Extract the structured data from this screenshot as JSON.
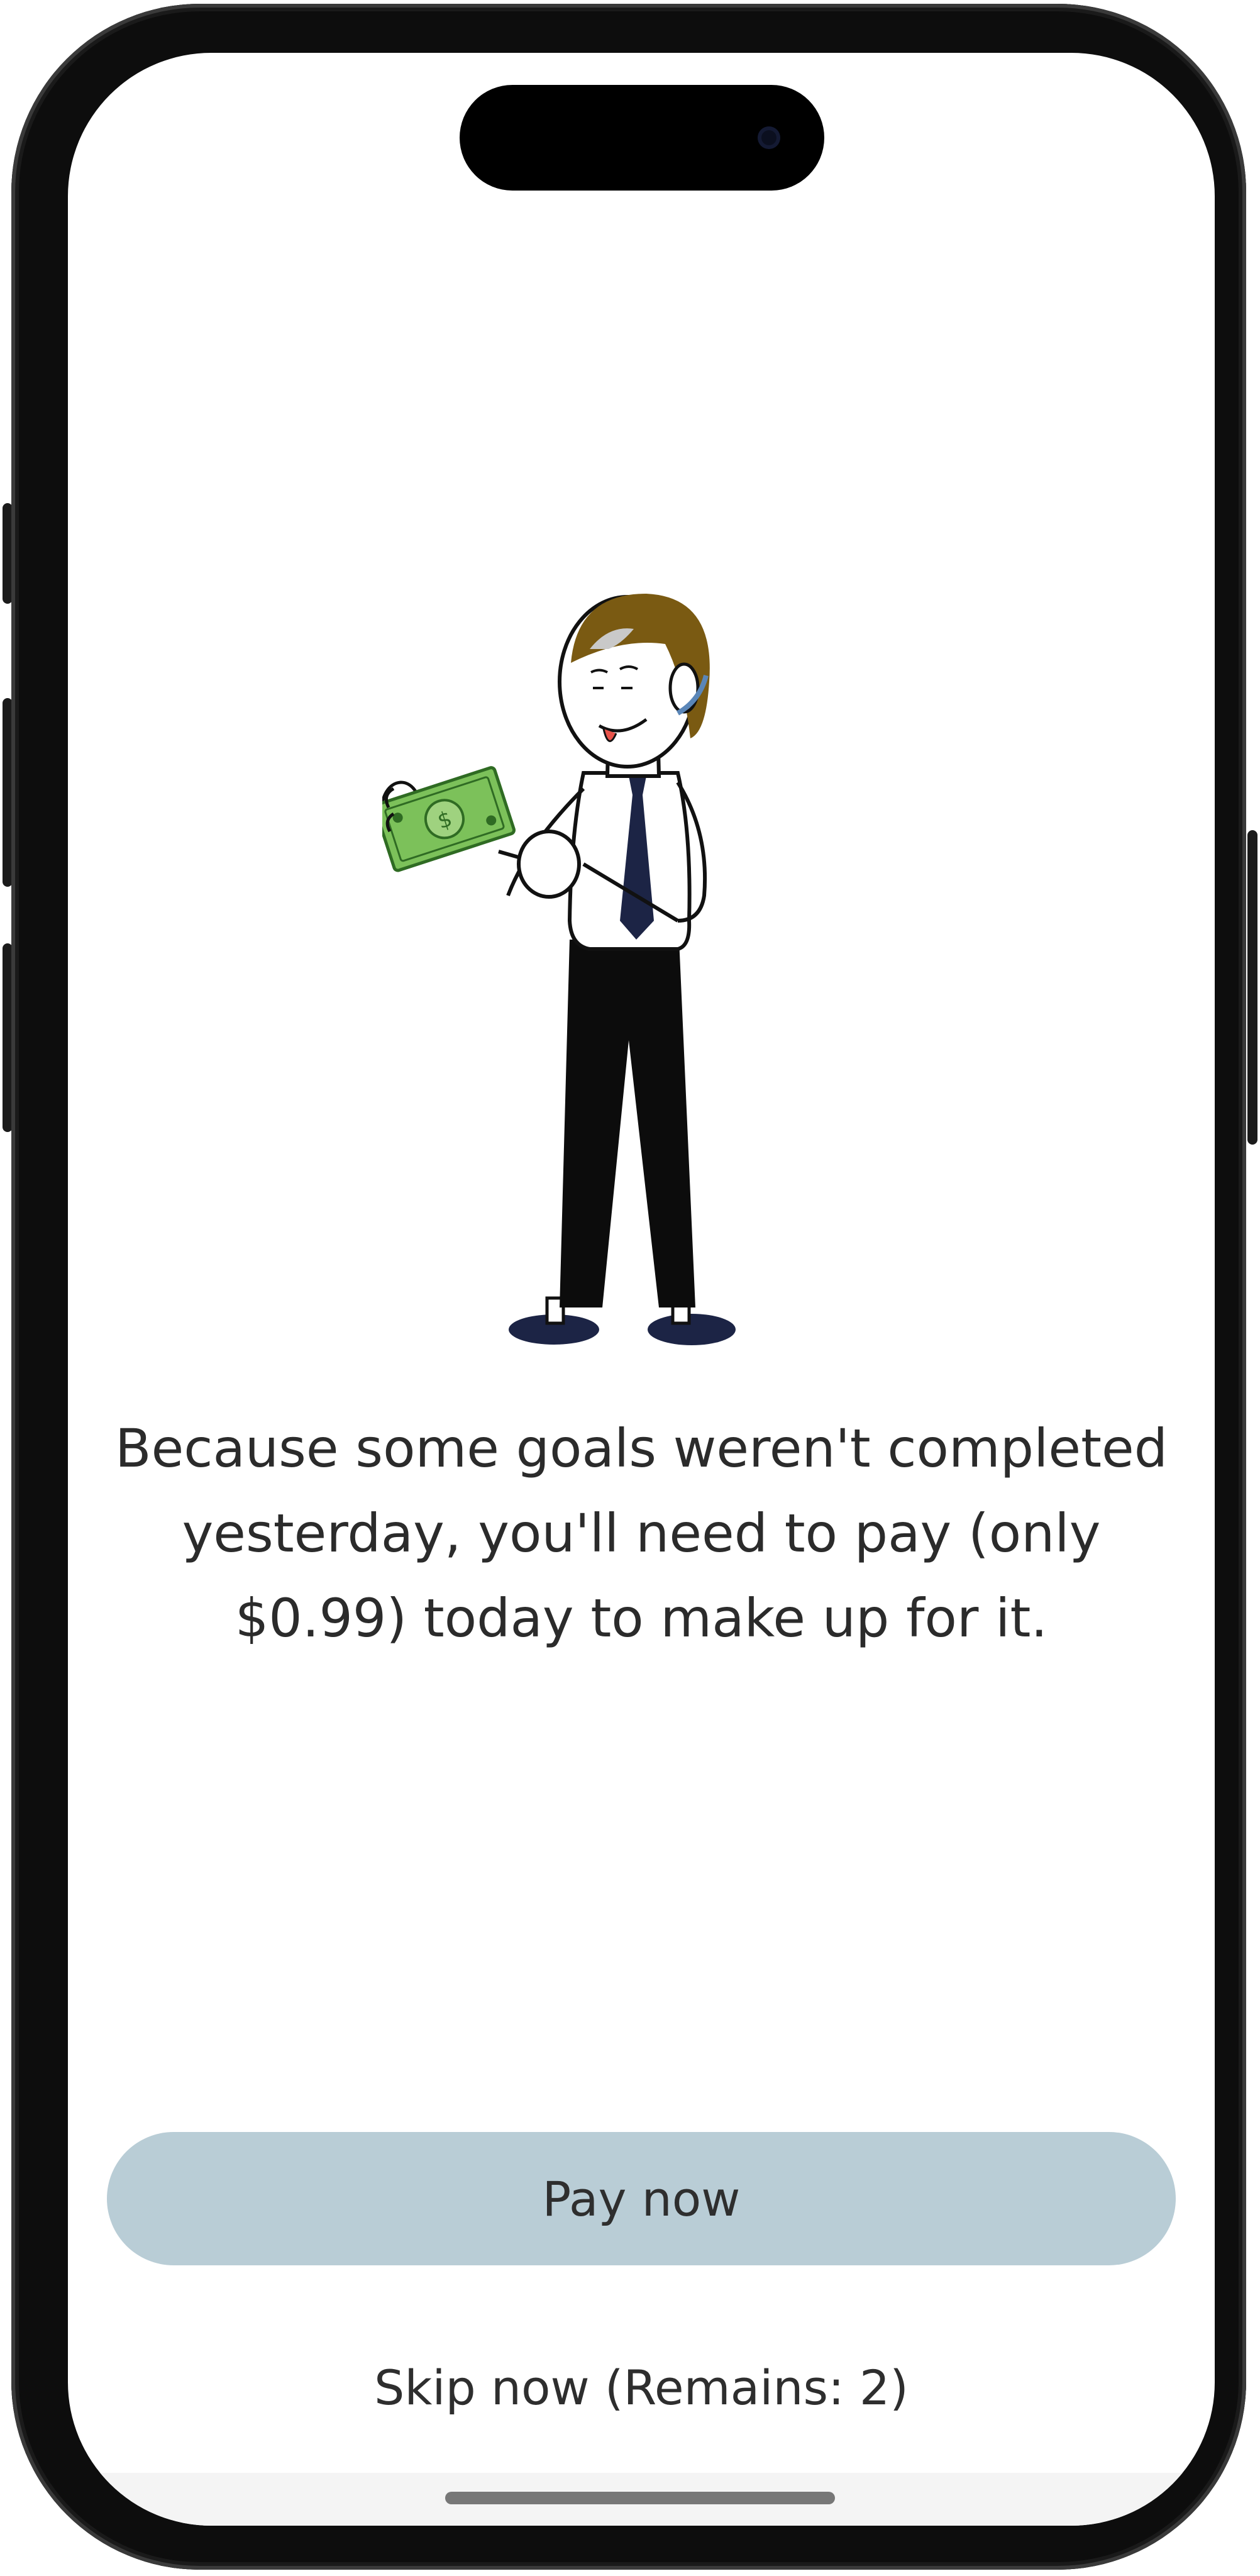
{
  "message": {
    "text": "Because some goals weren't completed yesterday, you'll need to pay (only $0.99) today to make up for it."
  },
  "actions": {
    "pay_label": "Pay now",
    "skip_label": "Skip now (Remains: 2)"
  },
  "illustration": {
    "icon": "man-holding-money-illustration"
  },
  "colors": {
    "pay_button_bg": "#b9cdd6",
    "text": "#2b2b2b",
    "bill_green": "#7cc15a",
    "hair": "#7a5a12",
    "tie": "#1c2445"
  }
}
